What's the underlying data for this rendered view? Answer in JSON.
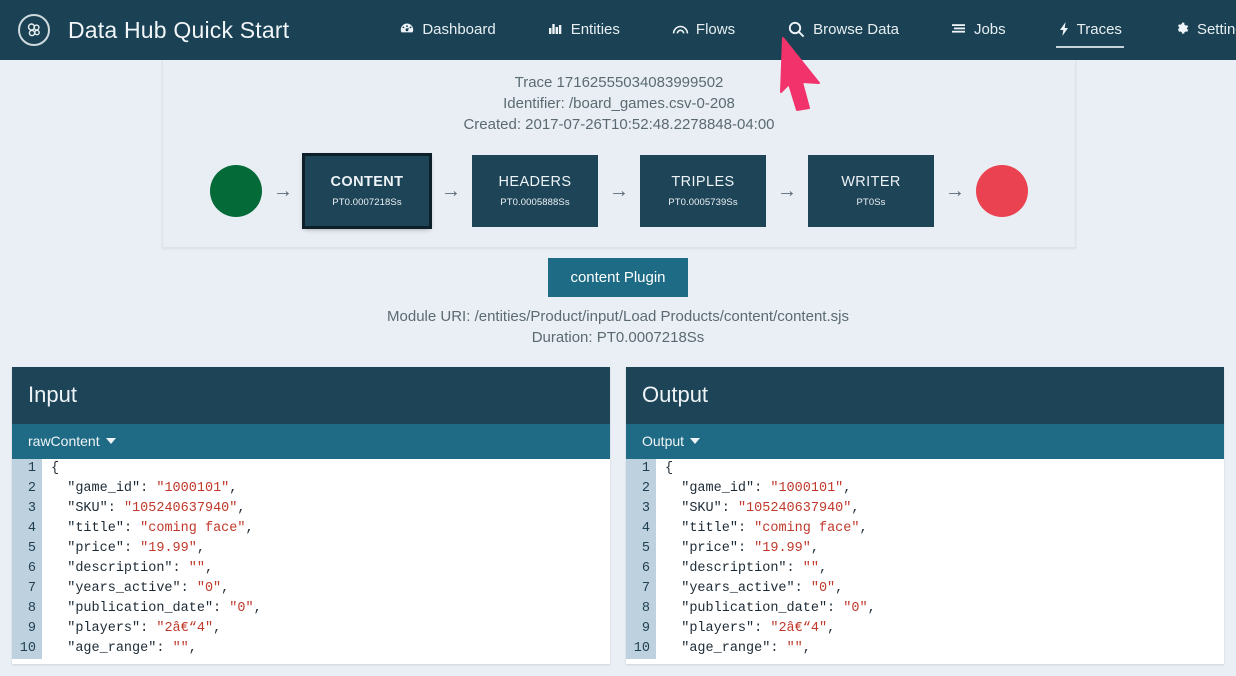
{
  "navbar": {
    "brand": "Data Hub Quick Start",
    "logo_icon": "datahub-logo-icon",
    "items": [
      {
        "label": "Dashboard",
        "icon": "dashboard-gauge-icon",
        "active": false
      },
      {
        "label": "Entities",
        "icon": "entities-chart-icon",
        "active": false
      },
      {
        "label": "Flows",
        "icon": "flows-arc-icon",
        "active": false
      },
      {
        "label": "Browse Data",
        "icon": "search-icon",
        "active": false
      },
      {
        "label": "Jobs",
        "icon": "jobs-list-icon",
        "active": false
      },
      {
        "label": "Traces",
        "icon": "bolt-icon",
        "active": true
      },
      {
        "label": "Settings",
        "icon": "gear-icon",
        "active": false
      }
    ],
    "user_icon": "user-avatar-icon",
    "bg_color": "#1b4254"
  },
  "trace": {
    "title": "Trace 17162555034083999502",
    "identifier": "Identifier: /board_games.csv-0-208",
    "created": "Created: 2017-07-26T10:52:48.2278848-04:00"
  },
  "flow": {
    "start_circle_color": "#046a38",
    "end_circle_color": "#ea4250",
    "arrow_glyph": "→",
    "steps": [
      {
        "name": "CONTENT",
        "duration": "PT0.0007218Ss",
        "selected": true
      },
      {
        "name": "HEADERS",
        "duration": "PT0.0005888Ss",
        "selected": false
      },
      {
        "name": "TRIPLES",
        "duration": "PT0.0005739Ss",
        "selected": false
      },
      {
        "name": "WRITER",
        "duration": "PT0Ss",
        "selected": false
      }
    ]
  },
  "plugin": {
    "button_label": "content Plugin",
    "module_uri": "Module URI: /entities/Product/input/Load Products/content/content.sjs",
    "duration": "Duration: PT0.0007218Ss"
  },
  "panels": [
    {
      "title": "Input",
      "selector": "rawContent",
      "lines": [
        {
          "n": "1",
          "text": "{"
        },
        {
          "n": "2",
          "text": "  \"game_id\": \"1000101\","
        },
        {
          "n": "3",
          "text": "  \"SKU\": \"105240637940\","
        },
        {
          "n": "4",
          "text": "  \"title\": \"coming face\","
        },
        {
          "n": "5",
          "text": "  \"price\": \"19.99\","
        },
        {
          "n": "6",
          "text": "  \"description\": \"\","
        },
        {
          "n": "7",
          "text": "  \"years_active\": \"0\","
        },
        {
          "n": "8",
          "text": "  \"publication_date\": \"0\","
        },
        {
          "n": "9",
          "text": "  \"players\": \"2â€“4\","
        },
        {
          "n": "10",
          "text": "  \"age_range\": \"\","
        }
      ]
    },
    {
      "title": "Output",
      "selector": "Output",
      "lines": [
        {
          "n": "1",
          "text": "{"
        },
        {
          "n": "2",
          "text": "  \"game_id\": \"1000101\","
        },
        {
          "n": "3",
          "text": "  \"SKU\": \"105240637940\","
        },
        {
          "n": "4",
          "text": "  \"title\": \"coming face\","
        },
        {
          "n": "5",
          "text": "  \"price\": \"19.99\","
        },
        {
          "n": "6",
          "text": "  \"description\": \"\","
        },
        {
          "n": "7",
          "text": "  \"years_active\": \"0\","
        },
        {
          "n": "8",
          "text": "  \"publication_date\": \"0\","
        },
        {
          "n": "9",
          "text": "  \"players\": \"2â€“4\","
        },
        {
          "n": "10",
          "text": "  \"age_range\": \"\","
        }
      ]
    }
  ],
  "cursor": {
    "icon": "mouse-arrow-cursor",
    "color": "#f2336b"
  }
}
